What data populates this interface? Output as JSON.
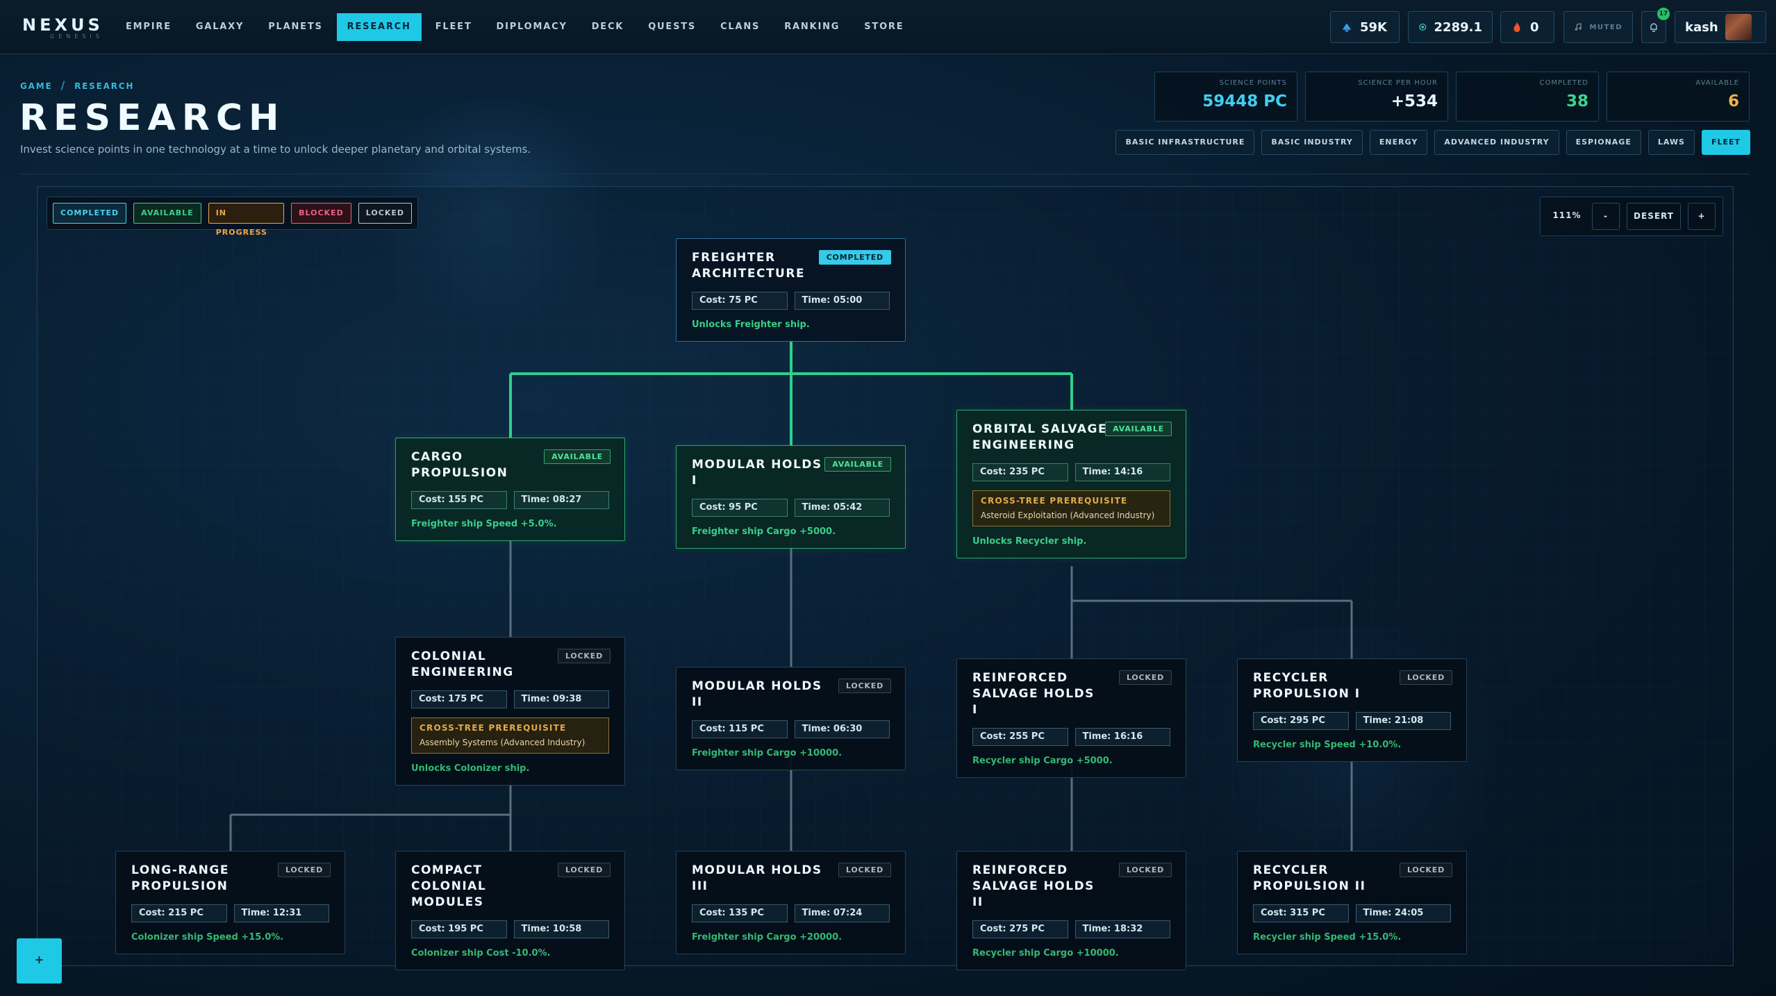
{
  "app": {
    "logo": "NEXUS",
    "logo_sub": "GENESIS"
  },
  "nav": [
    "EMPIRE",
    "GALAXY",
    "PLANETS",
    "RESEARCH",
    "FLEET",
    "DIPLOMACY",
    "DECK",
    "QUESTS",
    "CLANS",
    "RANKING",
    "STORE"
  ],
  "nav_active": "RESEARCH",
  "resources": {
    "credits": "59K",
    "energy": "2289.1",
    "alerts": "0",
    "music": "MUTED",
    "notifications": "17",
    "username": "kash"
  },
  "breadcrumb": {
    "root": "GAME",
    "sep": "/",
    "current": "RESEARCH"
  },
  "page": {
    "title": "RESEARCH",
    "subtitle": "Invest science points in one technology at a time to unlock deeper planetary and orbital systems."
  },
  "stats": [
    {
      "label": "SCIENCE POINTS",
      "value": "59448 PC",
      "color": "#3fd0f0"
    },
    {
      "label": "SCIENCE PER HOUR",
      "value": "+534",
      "color": "#eaf6fb"
    },
    {
      "label": "COMPLETED",
      "value": "38",
      "color": "#3ed38e"
    },
    {
      "label": "AVAILABLE",
      "value": "6",
      "color": "#f3b24a"
    }
  ],
  "categories": [
    "BASIC INFRASTRUCTURE",
    "BASIC INDUSTRY",
    "ENERGY",
    "ADVANCED INDUSTRY",
    "ESPIONAGE",
    "LAWS",
    "FLEET"
  ],
  "category_active": "FLEET",
  "legend": [
    "COMPLETED",
    "AVAILABLE",
    "IN PROGRESS",
    "BLOCKED",
    "LOCKED"
  ],
  "zoom": {
    "level": "111%",
    "minus": "-",
    "reset": "DESERT",
    "plus": "+"
  },
  "nodes": {
    "freighter": {
      "title": "FREIGHTER ARCHITECTURE",
      "status": "COMPLETED",
      "cost": "Cost: 75 PC",
      "time": "Time: 05:00",
      "effect": "Unlocks Freighter ship."
    },
    "cargo_prop": {
      "title": "CARGO PROPULSION",
      "status": "AVAILABLE",
      "cost": "Cost: 155 PC",
      "time": "Time: 08:27",
      "effect": "Freighter ship Speed +5.0%."
    },
    "modular1": {
      "title": "MODULAR HOLDS I",
      "status": "AVAILABLE",
      "cost": "Cost: 95 PC",
      "time": "Time: 05:42",
      "effect": "Freighter ship Cargo +5000."
    },
    "orbital": {
      "title": "ORBITAL SALVAGE ENGINEERING",
      "status": "AVAILABLE",
      "cost": "Cost: 235 PC",
      "time": "Time: 14:16",
      "prereq_title": "CROSS-TREE PREREQUISITE",
      "prereq_text": "Asteroid Exploitation (Advanced Industry)",
      "effect": "Unlocks Recycler ship."
    },
    "colonial": {
      "title": "COLONIAL ENGINEERING",
      "status": "LOCKED",
      "cost": "Cost: 175 PC",
      "time": "Time: 09:38",
      "prereq_title": "CROSS-TREE PREREQUISITE",
      "prereq_text": "Assembly Systems (Advanced Industry)",
      "effect": "Unlocks Colonizer ship."
    },
    "modular2": {
      "title": "MODULAR HOLDS II",
      "status": "LOCKED",
      "cost": "Cost: 115 PC",
      "time": "Time: 06:30",
      "effect": "Freighter ship Cargo +10000."
    },
    "reinforced1": {
      "title": "REINFORCED SALVAGE HOLDS I",
      "status": "LOCKED",
      "cost": "Cost: 255 PC",
      "time": "Time: 16:16",
      "effect": "Recycler ship Cargo +5000."
    },
    "recycler1": {
      "title": "RECYCLER PROPULSION I",
      "status": "LOCKED",
      "cost": "Cost: 295 PC",
      "time": "Time: 21:08",
      "effect": "Recycler ship Speed +10.0%."
    },
    "longrange": {
      "title": "LONG-RANGE PROPULSION",
      "status": "LOCKED",
      "cost": "Cost: 215 PC",
      "time": "Time: 12:31",
      "effect": "Colonizer ship Speed +15.0%."
    },
    "compact": {
      "title": "COMPACT COLONIAL MODULES",
      "status": "LOCKED",
      "cost": "Cost: 195 PC",
      "time": "Time: 10:58",
      "effect": "Colonizer ship Cost -10.0%."
    },
    "modular3": {
      "title": "MODULAR HOLDS III",
      "status": "LOCKED",
      "cost": "Cost: 135 PC",
      "time": "Time: 07:24",
      "effect": "Freighter ship Cargo +20000."
    },
    "reinforced2": {
      "title": "REINFORCED SALVAGE HOLDS II",
      "status": "LOCKED",
      "cost": "Cost: 275 PC",
      "time": "Time: 18:32",
      "effect": "Recycler ship Cargo +10000."
    },
    "recycler2": {
      "title": "RECYCLER PROPULSION II",
      "status": "LOCKED",
      "cost": "Cost: 315 PC",
      "time": "Time: 24:05",
      "effect": "Recycler ship Speed +15.0%."
    }
  },
  "fab": "+",
  "colors": {
    "accent": "#1fc9e6",
    "available": "#2ea86b",
    "prereq": "#e3aa4a",
    "locked": "#2a3f50"
  }
}
